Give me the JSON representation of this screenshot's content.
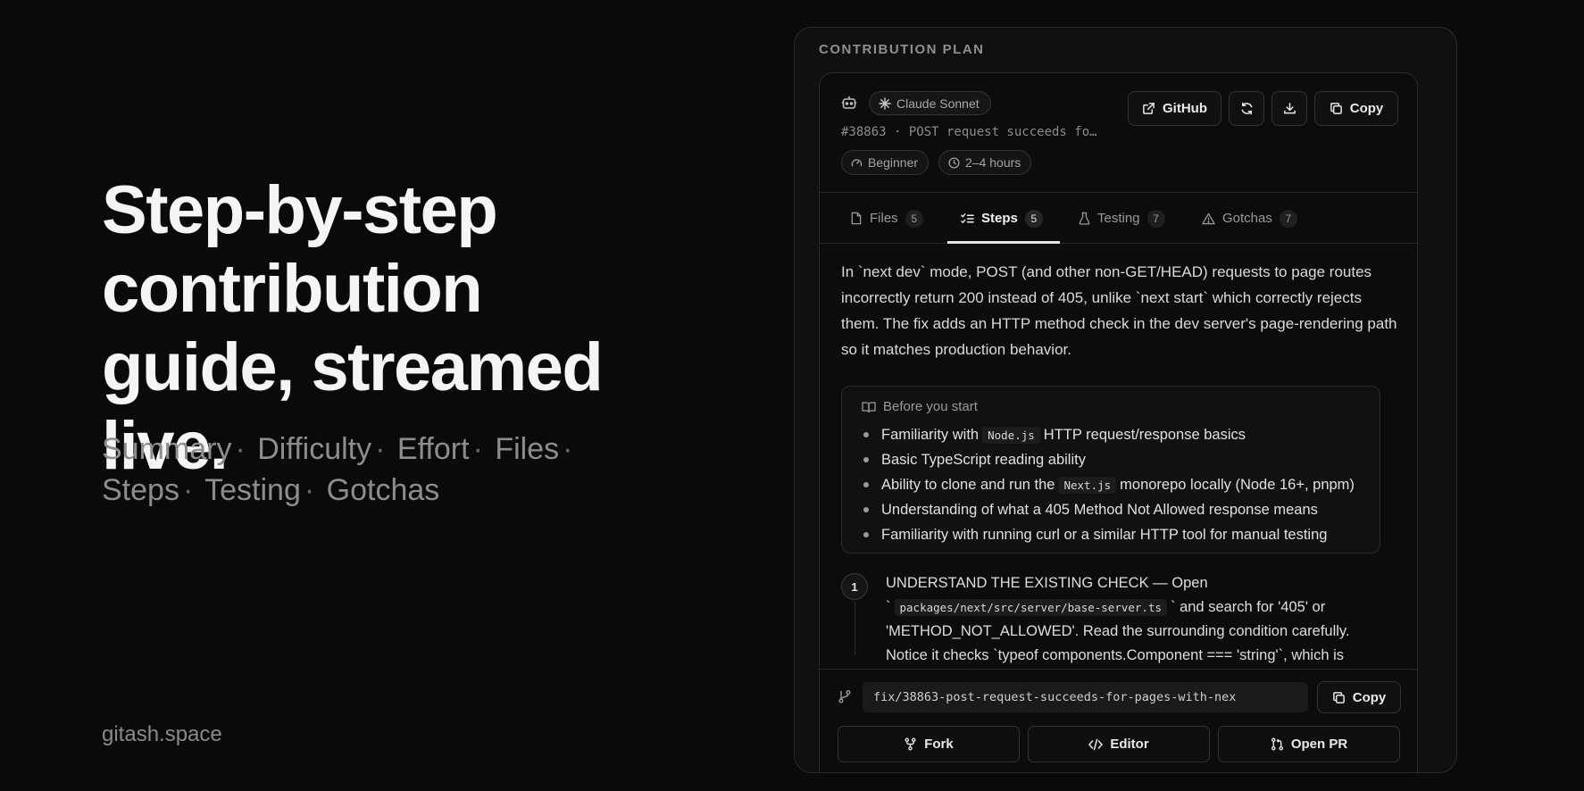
{
  "hero": {
    "title": "Step-by-step contribution guide, streamed live.",
    "features": [
      "Summary",
      "Difficulty",
      "Effort",
      "Files",
      "Steps",
      "Testing",
      "Gotchas"
    ],
    "separator": "·",
    "site": "gitash.space"
  },
  "panel": {
    "title": "CONTRIBUTION PLAN",
    "model": "Claude Sonnet",
    "issue": "#38863 · POST request succeeds fo…",
    "difficulty": "Beginner",
    "effort": "2–4 hours",
    "actions": {
      "github": "GitHub",
      "copy": "Copy"
    },
    "tabs": [
      {
        "label": "Files",
        "count": "5"
      },
      {
        "label": "Steps",
        "count": "5"
      },
      {
        "label": "Testing",
        "count": "7"
      },
      {
        "label": "Gotchas",
        "count": "7"
      }
    ],
    "active_tab": "Steps",
    "summary": "In `next dev` mode, POST (and other non-GET/HEAD) requests to page routes incorrectly return 200 instead of 405, unlike `next start` which correctly rejects them. The fix adds an HTTP method check in the dev server's page-rendering path so it matches production behavior.",
    "prereq": {
      "title": "Before you start",
      "items": [
        {
          "before": "Familiarity with",
          "code": "Node.js",
          "after": "HTTP request/response basics"
        },
        {
          "before": "Basic TypeScript reading ability",
          "code": "",
          "after": ""
        },
        {
          "before": "Ability to clone and run the",
          "code": "Next.js",
          "after": "monorepo locally (Node 16+, pnpm)"
        },
        {
          "before": "Understanding of what a 405 Method Not Allowed response means",
          "code": "",
          "after": ""
        },
        {
          "before": "Familiarity with running curl or a similar HTTP tool for manual testing",
          "code": "",
          "after": ""
        }
      ]
    },
    "step1": {
      "number": "1",
      "title": "UNDERSTAND THE EXISTING CHECK — Open",
      "path_prefix": "`",
      "path": "packages/next/src/server/base-server.ts",
      "rest": "` and search for '405' or 'METHOD_NOT_ALLOWED'. Read the surrounding condition carefully. Notice it checks `typeof components.Component === 'string'`, which is"
    },
    "footer": {
      "branch": "fix/38863-post-request-succeeds-for-pages-with-nex",
      "copy": "Copy",
      "fork": "Fork",
      "editor": "Editor",
      "open_pr": "Open PR"
    }
  }
}
